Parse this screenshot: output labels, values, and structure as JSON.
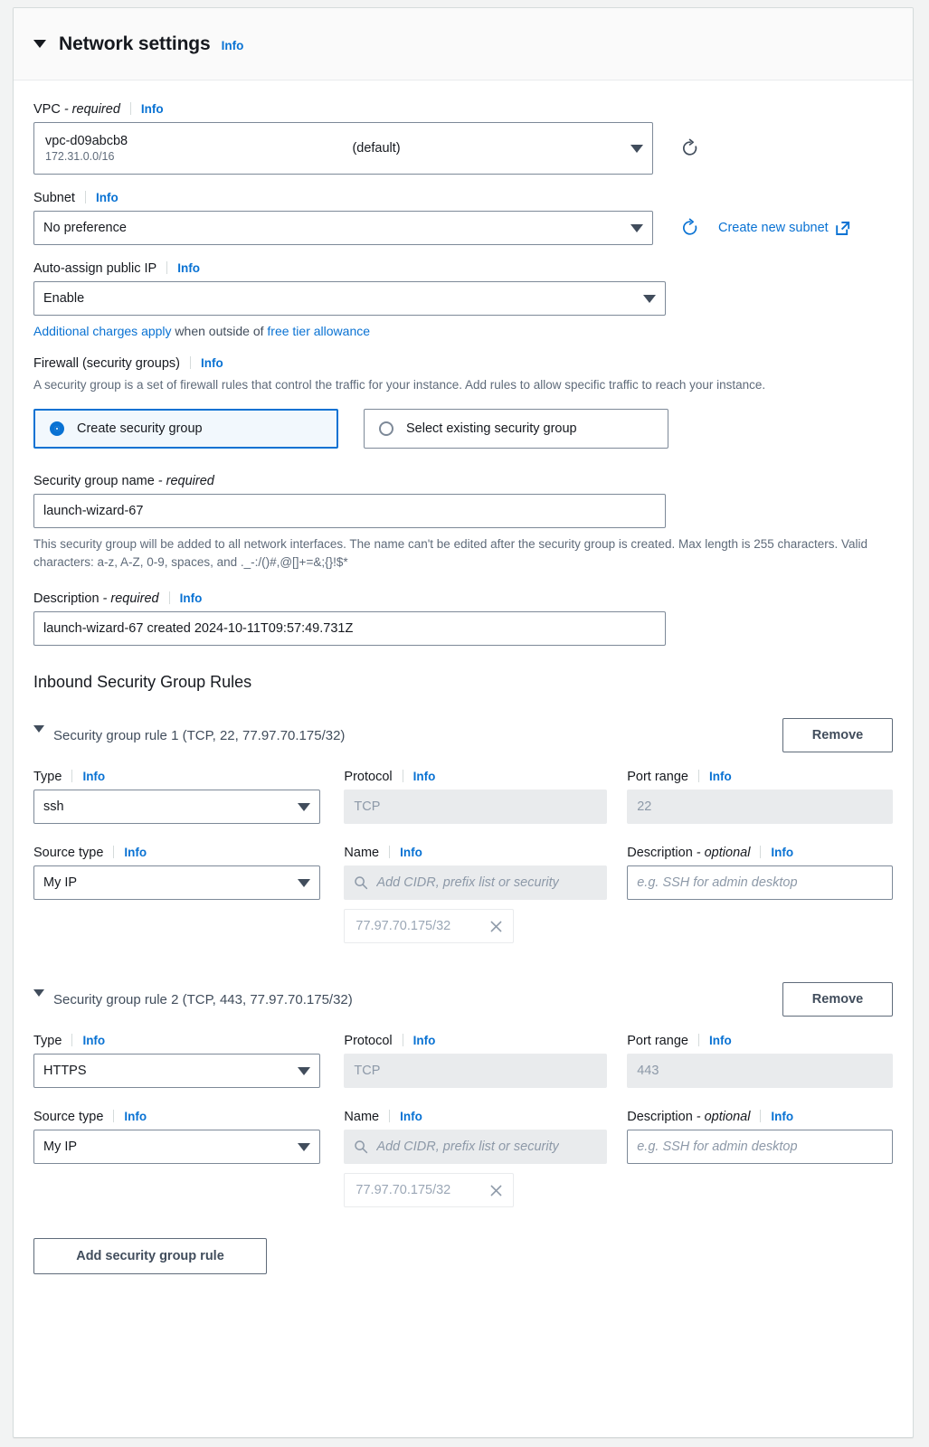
{
  "header": {
    "title": "Network settings",
    "info_label": "Info",
    "collapse_icon": "caret-down-icon"
  },
  "vpc": {
    "label": "VPC",
    "required_suffix": "- required",
    "info_label": "Info",
    "value_id": "vpc-d09abcb8",
    "value_cidr": "172.31.0.0/16",
    "value_tag": "(default)",
    "refresh_icon": "refresh-icon",
    "dropdown_icon": "caret-down-icon"
  },
  "subnet": {
    "label": "Subnet",
    "info_label": "Info",
    "value": "No preference",
    "refresh_icon": "refresh-icon",
    "create_link": "Create new subnet",
    "external_icon": "external-link-icon"
  },
  "auto_assign_ip": {
    "label": "Auto-assign public IP",
    "info_label": "Info",
    "value": "Enable",
    "note_link_1": "Additional charges apply",
    "note_middle": " when outside of ",
    "note_link_2": "free tier allowance"
  },
  "firewall": {
    "label": "Firewall (security groups)",
    "info_label": "Info",
    "description": "A security group is a set of firewall rules that control the traffic for your instance. Add rules to allow specific traffic to reach your instance.",
    "options": [
      {
        "label": "Create security group",
        "selected": true
      },
      {
        "label": "Select existing security group",
        "selected": false
      }
    ]
  },
  "sg_name": {
    "label": "Security group name",
    "required_suffix": "- required",
    "value": "launch-wizard-67",
    "helper": "This security group will be added to all network interfaces. The name can't be edited after the security group is created. Max length is 255 characters. Valid characters: a-z, A-Z, 0-9, spaces, and ._-:/()#,@[]+=&;{}!$*"
  },
  "sg_description": {
    "label": "Description",
    "required_suffix": "- required",
    "info_label": "Info",
    "value": "launch-wizard-67 created 2024-10-11T09:57:49.731Z"
  },
  "inbound": {
    "section_title": "Inbound Security Group Rules",
    "remove_label": "Remove",
    "add_rule_label": "Add security group rule",
    "field_labels": {
      "type": "Type",
      "protocol": "Protocol",
      "port_range": "Port range",
      "source_type": "Source type",
      "name": "Name",
      "description": "Description",
      "description_suffix": "- optional",
      "info": "Info"
    },
    "placeholders": {
      "name": "Add CIDR, prefix list or security",
      "description": "e.g. SSH for admin desktop"
    },
    "rules": [
      {
        "title": "Security group rule 1 (TCP, 22, 77.97.70.175/32)",
        "type": "ssh",
        "protocol": "TCP",
        "port_range": "22",
        "source_type": "My IP",
        "token": "77.97.70.175/32",
        "description_value": ""
      },
      {
        "title": "Security group rule 2 (TCP, 443, 77.97.70.175/32)",
        "type": "HTTPS",
        "protocol": "TCP",
        "port_range": "443",
        "source_type": "My IP",
        "token": "77.97.70.175/32",
        "description_value": ""
      }
    ]
  },
  "colors": {
    "link": "#0972d3",
    "text": "#16191f",
    "muted": "#5f6b7a",
    "disabled_bg": "#e9ebed",
    "border": "#7d8998",
    "selected_tile_bg": "#f2f8fd"
  }
}
